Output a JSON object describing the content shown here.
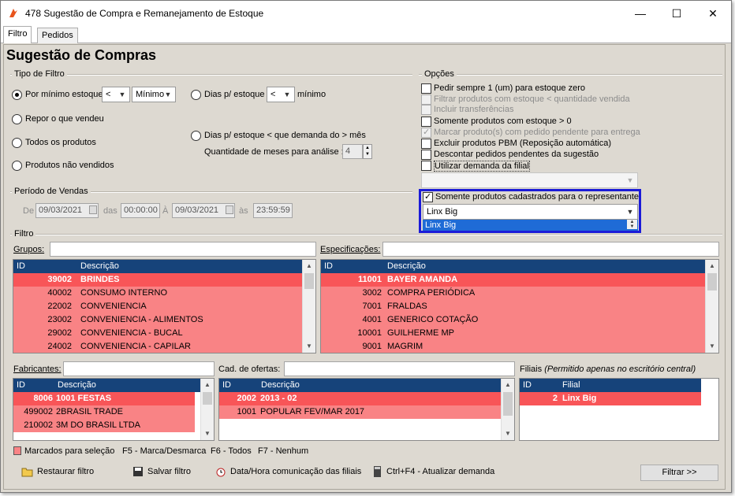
{
  "window": {
    "title": "478 Sugestão de Compra e Remanejamento de Estoque",
    "minimize": "—",
    "maximize": "☐",
    "close": "✕"
  },
  "tabs": [
    {
      "label": "Filtro"
    },
    {
      "label": "Pedidos"
    }
  ],
  "page_title": "Sugestão de Compras",
  "tipo_filtro": {
    "legend": "Tipo de Filtro",
    "por_minimo": "Por mínimo estoque",
    "op_value": "<",
    "min_value": "Mínimo",
    "dias_estoque": "Dias p/ estoque",
    "dias_op": "<",
    "minimo_label": "mínimo",
    "repor": "Repor o que vendeu",
    "todos": "Todos os produtos",
    "nao_vendidos": "Produtos não vendidos",
    "dias_demanda": "Dias p/ estoque < que demanda do > mês",
    "qtd_meses_label": "Quantidade de meses para análise :",
    "qtd_meses_value": "4"
  },
  "periodo": {
    "legend": "Período de Vendas",
    "de_label": "De",
    "de_date": "09/03/2021",
    "das_label": "das",
    "das_time": "00:00:00",
    "a_label": "À",
    "a_date": "09/03/2021",
    "as_label": "às",
    "as_time": "23:59:59"
  },
  "opcoes": {
    "legend": "Opções",
    "items": [
      {
        "label": "Pedir sempre 1 (um) para estoque zero"
      },
      {
        "label": "Filtrar produtos com estoque < quantidade vendida"
      },
      {
        "label": "Incluir transferências"
      },
      {
        "label": "Somente produtos com estoque > 0"
      },
      {
        "label": "Marcar produto(s) com pedido pendente para entrega"
      },
      {
        "label": "Excluir produtos PBM (Reposição automática)"
      },
      {
        "label": "Descontar pedidos pendentes da sugestão"
      },
      {
        "label": "Utilizar demanda da filial"
      }
    ],
    "representante_label": "Somente produtos cadastrados para o representante",
    "representante_value": "Linx Big",
    "representante_list_item": "Linx Big"
  },
  "filtro": {
    "legend": "Filtro",
    "grupos_label": "Grupos:",
    "especificacoes_label": "Especificações:",
    "fabricantes_label": "Fabricantes:",
    "ofertas_label": "Cad. de ofertas:",
    "filiais_label": "Filiais",
    "filiais_note": "(Permitido apenas no escritório central)"
  },
  "grupos": {
    "headers": [
      "ID",
      "Descrição"
    ],
    "rows": [
      {
        "id": "39002",
        "desc": "BRINDES"
      },
      {
        "id": "40002",
        "desc": "CONSUMO INTERNO"
      },
      {
        "id": "22002",
        "desc": "CONVENIENCIA"
      },
      {
        "id": "23002",
        "desc": "CONVENIENCIA - ALIMENTOS"
      },
      {
        "id": "29002",
        "desc": "CONVENIENCIA - BUCAL"
      },
      {
        "id": "24002",
        "desc": "CONVENIENCIA - CAPILAR"
      }
    ]
  },
  "especificacoes": {
    "headers": [
      "ID",
      "Descrição"
    ],
    "rows": [
      {
        "id": "11001",
        "desc": "BAYER AMANDA"
      },
      {
        "id": "3002",
        "desc": "COMPRA PERIÓDICA"
      },
      {
        "id": "7001",
        "desc": "FRALDAS"
      },
      {
        "id": "4001",
        "desc": "GENERICO COTAÇÃO"
      },
      {
        "id": "10001",
        "desc": "GUILHERME MP"
      },
      {
        "id": "9001",
        "desc": "MAGRIM"
      }
    ]
  },
  "fabricantes": {
    "headers": [
      "ID",
      "Descrição"
    ],
    "rows": [
      {
        "id": "8006",
        "desc": "1001 FESTAS"
      },
      {
        "id": "499002",
        "desc": "2BRASIL TRADE"
      },
      {
        "id": "210002",
        "desc": "3M DO BRASIL LTDA"
      }
    ]
  },
  "ofertas": {
    "headers": [
      "ID",
      "Descrição"
    ],
    "rows": [
      {
        "id": "2002",
        "desc": "2013 - 02"
      },
      {
        "id": "1001",
        "desc": "POPULAR FEV/MAR 2017"
      }
    ]
  },
  "filiais": {
    "headers": [
      "ID",
      "Filial"
    ],
    "rows": [
      {
        "id": "2",
        "desc": "Linx Big"
      }
    ]
  },
  "legend_bar": {
    "marcados": "Marcados para seleção",
    "f5": "F5 - Marca/Desmarca",
    "f6": "F6 - Todos",
    "f7": "F7 - Nenhum",
    "selected_color": "#f98385"
  },
  "toolbar": {
    "restaurar": "Restaurar filtro",
    "salvar": "Salvar filtro",
    "datahora": "Data/Hora comunicação das filiais",
    "atualizar": "Ctrl+F4 - Atualizar demanda",
    "filtrar": "Filtrar >>"
  }
}
